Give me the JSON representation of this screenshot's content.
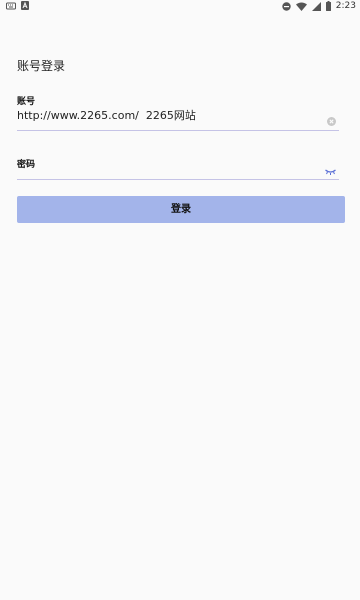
{
  "status_bar": {
    "time": "2:23",
    "left_icons": [
      "keyboard-icon",
      "a-notification-icon"
    ],
    "right_icons": [
      "do-not-disturb-icon",
      "wifi-icon",
      "signal-icon",
      "battery-icon"
    ]
  },
  "page": {
    "title": "账号登录"
  },
  "account": {
    "label": "账号",
    "value": "http://www.2265.com/  2265网站",
    "clear_icon": "clear-icon"
  },
  "password": {
    "label": "密码",
    "value": "",
    "toggle_icon": "eye-closed-icon"
  },
  "login": {
    "label": "登录",
    "color": "#a3b4ea"
  },
  "colors": {
    "background": "#fafafa",
    "underline": "#c5c3e6",
    "accent": "#a3b4ea",
    "eye_icon": "#5a6fd6"
  }
}
